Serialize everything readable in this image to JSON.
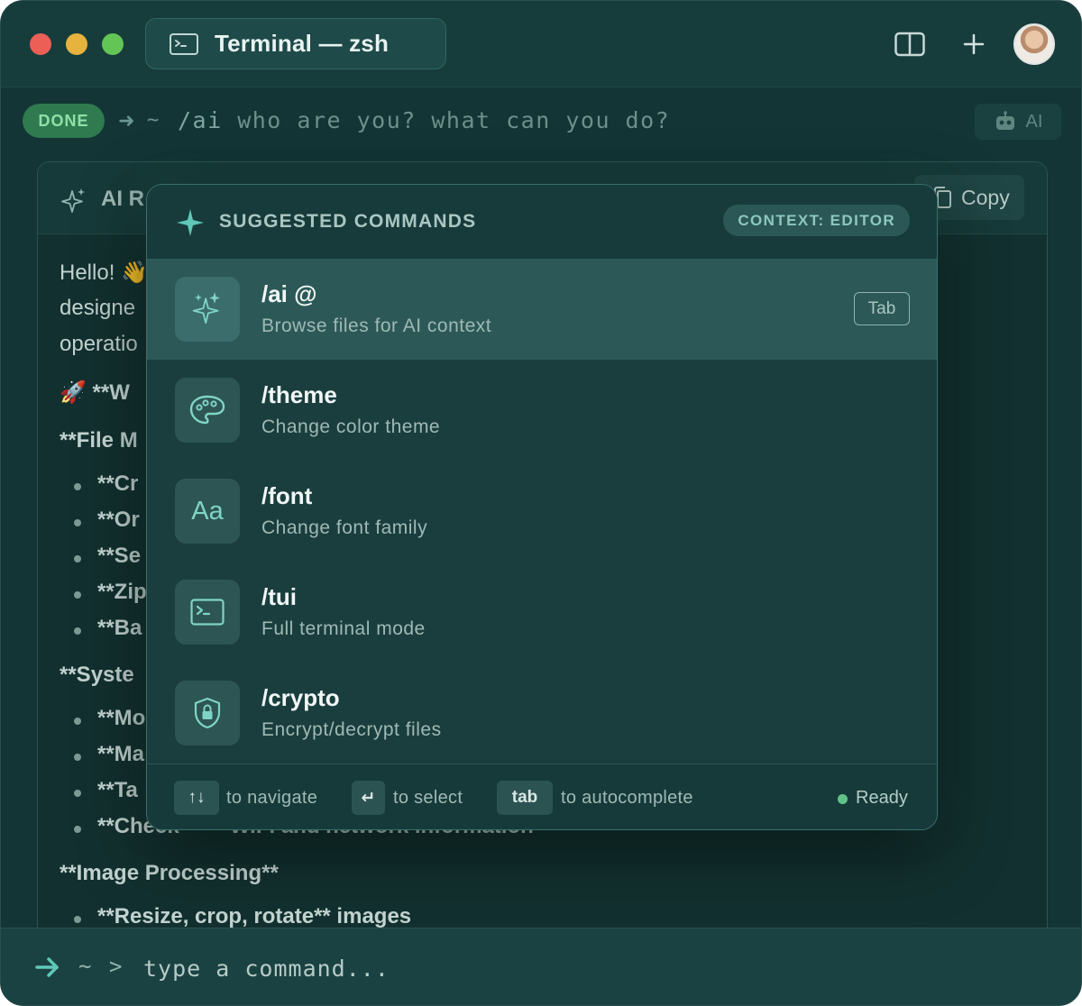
{
  "titlebar": {
    "tab_title": "Terminal — zsh",
    "icons": [
      "terminal-icon",
      "split-view-icon",
      "plus-icon"
    ]
  },
  "prompt": {
    "status": "DONE",
    "arrow": "➜",
    "tilde": "~",
    "command_slash": "/ai",
    "command_rest": " who are you? what can you do?",
    "ai_button_label": "AI"
  },
  "response": {
    "title": "AI R",
    "copy_label": "Copy",
    "lines": [
      {
        "text": "Hello! 👋",
        "bold": false
      },
      {
        "text": "designe",
        "bold": false
      },
      {
        "text": "operatio",
        "bold": false
      },
      {
        "text": "🚀 **W",
        "bold": true
      },
      {
        "text": "**File M",
        "bold": true
      },
      {
        "text": "**Cr",
        "bold": true,
        "bullet": true
      },
      {
        "text": "**Or",
        "bold": true,
        "bullet": true
      },
      {
        "text": "**Se",
        "bold": true,
        "bullet": true
      },
      {
        "text": "**Zip",
        "bold": true,
        "bullet": true
      },
      {
        "text": "**Ba",
        "bold": true,
        "bullet": true
      },
      {
        "text": "**Syste",
        "bold": true
      },
      {
        "text": "**Mo",
        "bold": true,
        "bullet": true
      },
      {
        "text": "**Ma",
        "bold": true,
        "bullet": true
      },
      {
        "text": "**Ta",
        "bold": true,
        "bullet": true
      },
      {
        "text": "**Check** — WiFi and network information",
        "bold": true,
        "bullet": true
      },
      {
        "text": "**Image Processing**",
        "bold": true
      },
      {
        "text": "**Resize, crop, rotate** images",
        "bold": true,
        "bullet": true
      }
    ]
  },
  "palette": {
    "title": "SUGGESTED COMMANDS",
    "context_badge": "CONTEXT: EDITOR",
    "items": [
      {
        "name": "/ai @",
        "desc": "Browse files for AI context",
        "icon": "sparkles-icon",
        "shortcut": "Tab",
        "active": true
      },
      {
        "name": "/theme",
        "desc": "Change color theme",
        "icon": "palette-icon",
        "active": false
      },
      {
        "name": "/font",
        "desc": "Change font family",
        "icon": "font-icon",
        "icon_text": "Aa",
        "active": false
      },
      {
        "name": "/tui",
        "desc": "Full terminal mode",
        "icon": "terminal-icon",
        "active": false
      },
      {
        "name": "/crypto",
        "desc": "Encrypt/decrypt files",
        "icon": "shield-lock-icon",
        "active": false
      }
    ],
    "footer": {
      "navigate_key": "↑↓",
      "navigate_label": "to navigate",
      "select_key": "↵",
      "select_label": "to select",
      "tab_key": "tab",
      "tab_label": "to autocomplete",
      "status": "Ready"
    }
  },
  "bottom": {
    "arrow": "➜",
    "tilde": "~",
    "caret": ">",
    "placeholder": "type a command..."
  },
  "colors": {
    "background": "#133535",
    "accent": "#5fc8b8",
    "done_badge": "#2f7a4f",
    "ready": "#5fc389"
  }
}
